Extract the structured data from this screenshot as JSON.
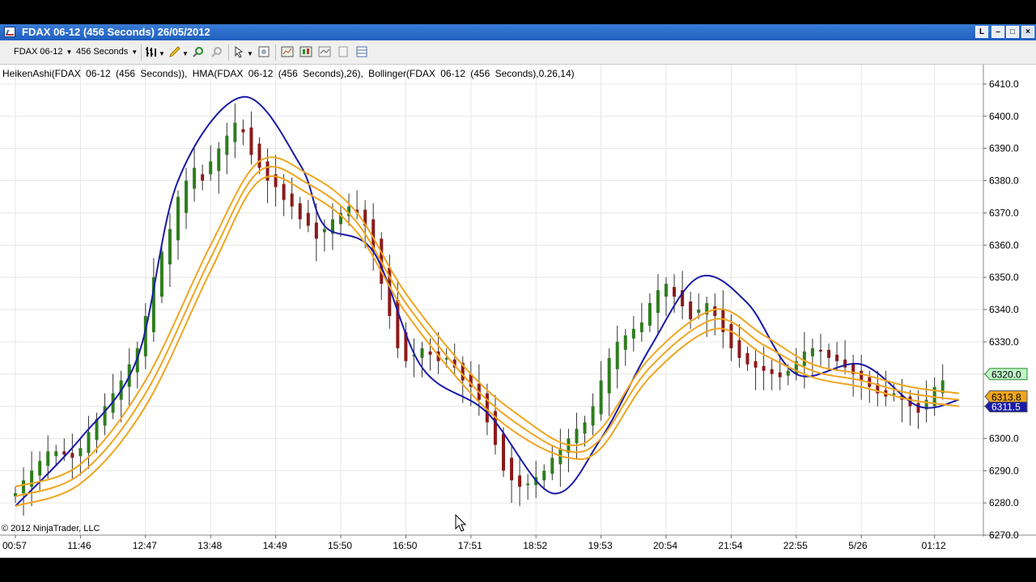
{
  "window": {
    "title": "FDAX 06-12 (456 Seconds)  26/05/2012",
    "buttons": [
      "L",
      "–",
      "□",
      "×"
    ]
  },
  "toolbar": {
    "instrument": "FDAX 06-12",
    "interval": "456 Seconds"
  },
  "chart_panel": {
    "indicator_label": "HeikenAshi(FDAX 06-12 (456 Seconds)), HMA(FDAX 06-12 (456 Seconds),26), Bollinger(FDAX 06-12 (456 Seconds),0.26,14)",
    "copyright": "© 2012 NinjaTrader, LLC"
  },
  "colors": {
    "background": "#ffffff",
    "bullish": "#2e7d1e",
    "bearish": "#8b1a1a",
    "hma": "#1a1aa6",
    "bollinger": "#f0a520",
    "grid": "#e6e6e6",
    "titlebar": "#2a6ccc",
    "price_badge_green": "#bff5c8",
    "price_badge_orange": "#f0a520",
    "price_badge_blue": "#1a1aa6"
  },
  "chart_data": {
    "type": "candlestick",
    "title": "",
    "xlabel": "",
    "ylabel": "",
    "ylim": [
      6270,
      6414
    ],
    "y_ticks": [
      6410,
      6400,
      6390,
      6380,
      6370,
      6360,
      6350,
      6340,
      6330,
      6320,
      6310,
      6300,
      6290,
      6280,
      6270
    ],
    "y_tick_labels": [
      "6410.0",
      "6400.0",
      "6390.0",
      "6380.0",
      "6370.0",
      "6360.0",
      "6350.0",
      "6340.0",
      "6330.0",
      "6320.0",
      "6310.0",
      "6300.0",
      "6290.0",
      "6280.0",
      "6270.0"
    ],
    "x_tick_labels": [
      "00:57",
      "11:46",
      "12:47",
      "13:48",
      "14:49",
      "15:50",
      "16:50",
      "17:51",
      "18:52",
      "19:53",
      "20:54",
      "21:54",
      "22:55",
      "5/26",
      "01:12"
    ],
    "x_tick_bar_index": [
      0,
      8,
      16,
      24,
      32,
      40,
      48,
      56,
      64,
      72,
      80,
      88,
      96,
      104,
      113
    ],
    "bars_heiken_ashi_close": [
      6283,
      6287,
      6290,
      6293,
      6296,
      6296,
      6295,
      6294,
      6297,
      6302,
      6306,
      6310,
      6314,
      6318,
      6323,
      6328,
      6338,
      6350,
      6358,
      6365,
      6375,
      6380,
      6384,
      6380,
      6386,
      6390,
      6394,
      6398,
      6395,
      6388,
      6384,
      6380,
      6378,
      6374,
      6372,
      6368,
      6366,
      6362,
      6365,
      6368,
      6370,
      6372,
      6370,
      6366,
      6358,
      6348,
      6338,
      6328,
      6324,
      6326,
      6328,
      6326,
      6324,
      6325,
      6322,
      6318,
      6316,
      6312,
      6305,
      6298,
      6290,
      6287,
      6285,
      6286,
      6288,
      6290,
      6294,
      6297,
      6300,
      6303,
      6305,
      6310,
      6318,
      6325,
      6330,
      6332,
      6334,
      6336,
      6342,
      6346,
      6348,
      6344,
      6341,
      6337,
      6340,
      6342,
      6338,
      6333,
      6328,
      6325,
      6323,
      6322,
      6321,
      6320,
      6319,
      6321,
      6324,
      6327,
      6328,
      6327,
      6325,
      6324,
      6322,
      6320,
      6318,
      6316,
      6314,
      6313,
      6314,
      6312,
      6310,
      6308,
      6312,
      6316,
      6318
    ],
    "series": [
      {
        "name": "HMA",
        "x": [
          0,
          8,
          15,
          20,
          28,
          35,
          38,
          44,
          50,
          58,
          66,
          72,
          78,
          84,
          90,
          96,
          104,
          111,
          116
        ],
        "values": [
          6279,
          6300,
          6325,
          6380,
          6406,
          6385,
          6366,
          6358,
          6322,
          6308,
          6283,
          6300,
          6328,
          6350,
          6342,
          6320,
          6323,
          6310,
          6312
        ]
      },
      {
        "name": "Bollinger Upper",
        "x": [
          0,
          8,
          16,
          24,
          30,
          36,
          42,
          48,
          56,
          62,
          68,
          72,
          78,
          86,
          92,
          98,
          104,
          110,
          116
        ],
        "values": [
          6285,
          6292,
          6318,
          6360,
          6386,
          6382,
          6370,
          6345,
          6320,
          6307,
          6298,
          6303,
          6325,
          6340,
          6332,
          6323,
          6320,
          6316,
          6314
        ]
      },
      {
        "name": "Bollinger Middle",
        "x": [
          0,
          8,
          16,
          24,
          30,
          36,
          42,
          48,
          56,
          62,
          68,
          72,
          78,
          86,
          92,
          98,
          104,
          110,
          116
        ],
        "values": [
          6282,
          6289,
          6314,
          6356,
          6383,
          6379,
          6367,
          6342,
          6317,
          6304,
          6296,
          6300,
          6322,
          6337,
          6329,
          6321,
          6318,
          6314,
          6312
        ]
      },
      {
        "name": "Bollinger Lower",
        "x": [
          0,
          8,
          16,
          24,
          30,
          36,
          42,
          48,
          56,
          62,
          68,
          72,
          78,
          86,
          92,
          98,
          104,
          110,
          116
        ],
        "values": [
          6279,
          6286,
          6310,
          6352,
          6380,
          6376,
          6364,
          6339,
          6314,
          6301,
          6294,
          6297,
          6319,
          6334,
          6326,
          6319,
          6316,
          6312,
          6310
        ]
      }
    ],
    "price_markers": [
      {
        "label": "6320.0",
        "value": 6320.0,
        "color": "green"
      },
      {
        "label": "6313.8",
        "value": 6313.8,
        "color": "orange"
      },
      {
        "label": "6311.5",
        "value": 6311.5,
        "color": "blue"
      }
    ],
    "grid": true
  }
}
